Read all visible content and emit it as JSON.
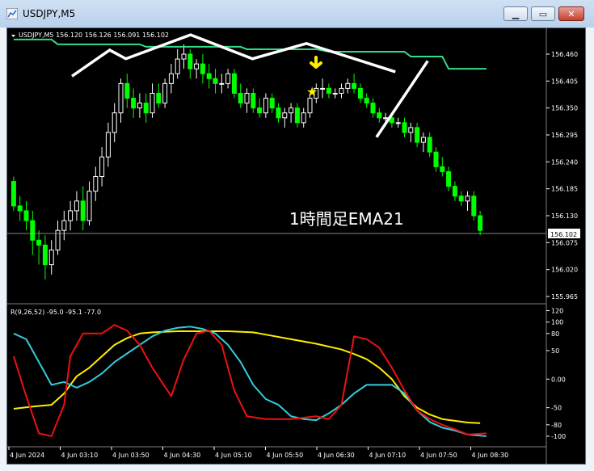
{
  "window": {
    "title": "USDJPY,M5",
    "buttons": {
      "minimize": "▁",
      "maximize": "▭",
      "close": "✕"
    }
  },
  "chart": {
    "header": "USDJPY,M5  156.120 156.126 156.091 156.102",
    "current_price": "156.102",
    "annotation": "1時間足EMA21",
    "price_axis": [
      "156.460",
      "156.405",
      "156.350",
      "156.295",
      "156.240",
      "156.185",
      "156.130",
      "156.075",
      "156.020",
      "155.965"
    ],
    "time_axis": [
      "4 Jun 2024",
      "4 Jun 03:10",
      "4 Jun 03:50",
      "4 Jun 04:30",
      "4 Jun 05:10",
      "4 Jun 05:50",
      "4 Jun 06:30",
      "4 Jun 07:10",
      "4 Jun 07:50",
      "4 Jun 08:30"
    ],
    "colors": {
      "background": "#000000",
      "up": "#ffffff",
      "down": "#00ff00",
      "ema": "#33dd88",
      "annotation": "#ffffff",
      "marker": "#ffee00"
    },
    "candles": [
      [
        156.2,
        156.21,
        156.14,
        156.15
      ],
      [
        156.15,
        156.17,
        156.12,
        156.14
      ],
      [
        156.14,
        156.16,
        156.1,
        156.12
      ],
      [
        156.12,
        156.14,
        156.05,
        156.08
      ],
      [
        156.08,
        156.1,
        156.03,
        156.07
      ],
      [
        156.07,
        156.09,
        156.0,
        156.03
      ],
      [
        156.03,
        156.08,
        156.01,
        156.06
      ],
      [
        156.06,
        156.12,
        156.05,
        156.1
      ],
      [
        156.1,
        156.14,
        156.08,
        156.12
      ],
      [
        156.12,
        156.16,
        156.1,
        156.14
      ],
      [
        156.14,
        156.18,
        156.12,
        156.16
      ],
      [
        156.16,
        156.19,
        156.1,
        156.12
      ],
      [
        156.12,
        156.2,
        156.11,
        156.18
      ],
      [
        156.18,
        156.23,
        156.16,
        156.21
      ],
      [
        156.21,
        156.27,
        156.19,
        156.25
      ],
      [
        156.25,
        156.32,
        156.23,
        156.3
      ],
      [
        156.3,
        156.36,
        156.28,
        156.34
      ],
      [
        156.34,
        156.41,
        156.32,
        156.4
      ],
      [
        156.4,
        156.42,
        156.35,
        156.37
      ],
      [
        156.37,
        156.39,
        156.33,
        156.35
      ],
      [
        156.35,
        156.38,
        156.33,
        156.36
      ],
      [
        156.36,
        156.38,
        156.32,
        156.34
      ],
      [
        156.34,
        156.4,
        156.33,
        156.38
      ],
      [
        156.38,
        156.4,
        156.35,
        156.36
      ],
      [
        156.36,
        156.41,
        156.35,
        156.4
      ],
      [
        156.4,
        156.44,
        156.38,
        156.42
      ],
      [
        156.42,
        156.47,
        156.41,
        156.45
      ],
      [
        156.45,
        156.48,
        156.43,
        156.46
      ],
      [
        156.46,
        156.47,
        156.41,
        156.43
      ],
      [
        156.43,
        156.45,
        156.41,
        156.44
      ],
      [
        156.44,
        156.46,
        156.4,
        156.42
      ],
      [
        156.42,
        156.44,
        156.39,
        156.41
      ],
      [
        156.41,
        156.43,
        156.38,
        156.4
      ],
      [
        156.4,
        156.42,
        156.38,
        156.4
      ],
      [
        156.4,
        156.43,
        156.39,
        156.42
      ],
      [
        156.42,
        156.43,
        156.37,
        156.38
      ],
      [
        156.38,
        156.4,
        156.35,
        156.36
      ],
      [
        156.36,
        156.39,
        156.34,
        156.38
      ],
      [
        156.38,
        156.39,
        156.34,
        156.35
      ],
      [
        156.35,
        156.37,
        156.33,
        156.34
      ],
      [
        156.34,
        156.38,
        156.33,
        156.37
      ],
      [
        156.37,
        156.38,
        156.34,
        156.35
      ],
      [
        156.35,
        156.36,
        156.32,
        156.33
      ],
      [
        156.33,
        156.35,
        156.31,
        156.34
      ],
      [
        156.34,
        156.36,
        156.32,
        156.35
      ],
      [
        156.35,
        156.36,
        156.31,
        156.32
      ],
      [
        156.32,
        156.35,
        156.31,
        156.34
      ],
      [
        156.34,
        156.38,
        156.33,
        156.37
      ],
      [
        156.37,
        156.4,
        156.36,
        156.39
      ],
      [
        156.39,
        156.41,
        156.37,
        156.39
      ],
      [
        156.39,
        156.4,
        156.37,
        156.38
      ],
      [
        156.38,
        156.39,
        156.37,
        156.38
      ],
      [
        156.38,
        156.4,
        156.37,
        156.39
      ],
      [
        156.39,
        156.41,
        156.38,
        156.4
      ],
      [
        156.4,
        156.42,
        156.38,
        156.39
      ],
      [
        156.39,
        156.4,
        156.36,
        156.37
      ],
      [
        156.37,
        156.38,
        156.35,
        156.36
      ],
      [
        156.36,
        156.37,
        156.33,
        156.34
      ],
      [
        156.34,
        156.35,
        156.32,
        156.33
      ],
      [
        156.33,
        156.34,
        156.32,
        156.33
      ],
      [
        156.33,
        156.34,
        156.31,
        156.32
      ],
      [
        156.32,
        156.33,
        156.31,
        156.32
      ],
      [
        156.32,
        156.33,
        156.29,
        156.3
      ],
      [
        156.3,
        156.32,
        156.28,
        156.31
      ],
      [
        156.31,
        156.32,
        156.27,
        156.28
      ],
      [
        156.28,
        156.3,
        156.26,
        156.29
      ],
      [
        156.29,
        156.3,
        156.25,
        156.26
      ],
      [
        156.26,
        156.27,
        156.22,
        156.23
      ],
      [
        156.23,
        156.25,
        156.21,
        156.22
      ],
      [
        156.22,
        156.23,
        156.18,
        156.19
      ],
      [
        156.19,
        156.2,
        156.16,
        156.17
      ],
      [
        156.17,
        156.18,
        156.15,
        156.16
      ],
      [
        156.16,
        156.18,
        156.14,
        156.17
      ],
      [
        156.17,
        156.18,
        156.12,
        156.13
      ],
      [
        156.13,
        156.14,
        156.09,
        156.1
      ]
    ],
    "ema": [
      [
        0,
        156.49
      ],
      [
        6,
        156.49
      ],
      [
        7,
        156.48
      ],
      [
        20,
        156.48
      ],
      [
        21,
        156.475
      ],
      [
        36,
        156.475
      ],
      [
        37,
        156.47
      ],
      [
        48,
        156.47
      ],
      [
        50,
        156.465
      ],
      [
        62,
        156.465
      ],
      [
        63,
        156.455
      ],
      [
        68,
        156.455
      ],
      [
        69,
        156.43
      ],
      [
        75,
        156.43
      ]
    ],
    "hand_lines": [
      [
        [
          0.12,
          0.11
        ],
        [
          0.19,
          0.05
        ],
        [
          0.22,
          0.07
        ],
        [
          0.34,
          0.015
        ],
        [
          0.455,
          0.07
        ],
        [
          0.555,
          0.035
        ],
        [
          0.72,
          0.1
        ]
      ],
      [
        [
          0.685,
          0.25
        ],
        [
          0.78,
          0.075
        ]
      ]
    ]
  },
  "indicator": {
    "label": "R(9,26,52) -95.0 -95.1 -77.0",
    "axis": [
      "120",
      "100",
      "80",
      "50",
      "0.00",
      "-50",
      "-80",
      "-100"
    ],
    "ylim": [
      -110,
      125
    ],
    "red": [
      [
        0,
        40
      ],
      [
        2,
        -30
      ],
      [
        4,
        -95
      ],
      [
        6,
        -100
      ],
      [
        8,
        -45
      ],
      [
        9,
        40
      ],
      [
        11,
        80
      ],
      [
        14,
        80
      ],
      [
        16,
        95
      ],
      [
        18,
        85
      ],
      [
        20,
        60
      ],
      [
        22,
        20
      ],
      [
        25,
        -30
      ],
      [
        27,
        35
      ],
      [
        29,
        80
      ],
      [
        31,
        85
      ],
      [
        33,
        60
      ],
      [
        35,
        -20
      ],
      [
        37,
        -65
      ],
      [
        40,
        -70
      ],
      [
        44,
        -70
      ],
      [
        48,
        -65
      ],
      [
        50,
        -70
      ],
      [
        52,
        -45
      ],
      [
        54,
        75
      ],
      [
        56,
        70
      ],
      [
        58,
        55
      ],
      [
        60,
        20
      ],
      [
        62,
        -20
      ],
      [
        64,
        -55
      ],
      [
        66,
        -70
      ],
      [
        68,
        -80
      ],
      [
        70,
        -88
      ],
      [
        72,
        -97
      ],
      [
        75,
        -95
      ]
    ],
    "cyan": [
      [
        0,
        80
      ],
      [
        2,
        70
      ],
      [
        4,
        30
      ],
      [
        6,
        -10
      ],
      [
        8,
        -5
      ],
      [
        10,
        -15
      ],
      [
        12,
        -5
      ],
      [
        14,
        10
      ],
      [
        16,
        30
      ],
      [
        18,
        45
      ],
      [
        20,
        60
      ],
      [
        22,
        75
      ],
      [
        24,
        85
      ],
      [
        26,
        90
      ],
      [
        28,
        92
      ],
      [
        30,
        88
      ],
      [
        32,
        80
      ],
      [
        34,
        60
      ],
      [
        36,
        30
      ],
      [
        38,
        -10
      ],
      [
        40,
        -35
      ],
      [
        42,
        -45
      ],
      [
        44,
        -65
      ],
      [
        46,
        -70
      ],
      [
        48,
        -72
      ],
      [
        50,
        -60
      ],
      [
        52,
        -45
      ],
      [
        54,
        -25
      ],
      [
        56,
        -10
      ],
      [
        58,
        -10
      ],
      [
        60,
        -10
      ],
      [
        62,
        -25
      ],
      [
        64,
        -55
      ],
      [
        66,
        -75
      ],
      [
        68,
        -85
      ],
      [
        70,
        -90
      ],
      [
        72,
        -97
      ],
      [
        75,
        -100
      ]
    ],
    "yellow": [
      [
        0,
        -52
      ],
      [
        3,
        -48
      ],
      [
        6,
        -45
      ],
      [
        8,
        -25
      ],
      [
        10,
        5
      ],
      [
        12,
        20
      ],
      [
        14,
        40
      ],
      [
        16,
        60
      ],
      [
        18,
        72
      ],
      [
        20,
        80
      ],
      [
        22,
        82
      ],
      [
        26,
        84
      ],
      [
        30,
        84
      ],
      [
        34,
        84
      ],
      [
        38,
        82
      ],
      [
        40,
        78
      ],
      [
        44,
        70
      ],
      [
        48,
        62
      ],
      [
        52,
        52
      ],
      [
        54,
        44
      ],
      [
        56,
        35
      ],
      [
        58,
        20
      ],
      [
        60,
        0
      ],
      [
        62,
        -30
      ],
      [
        64,
        -50
      ],
      [
        66,
        -62
      ],
      [
        68,
        -70
      ],
      [
        70,
        -73
      ],
      [
        72,
        -76
      ],
      [
        74,
        -77
      ]
    ]
  }
}
